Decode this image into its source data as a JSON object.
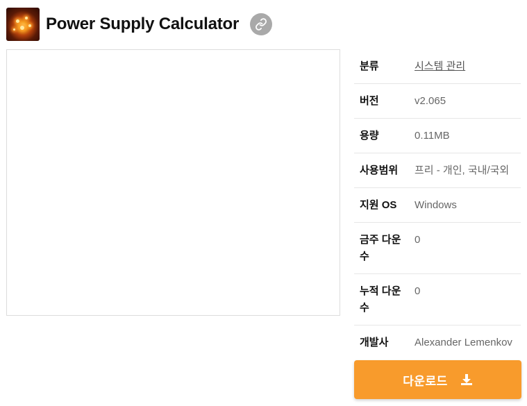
{
  "header": {
    "title": "Power Supply Calculator",
    "app_icon": "app-logo-icon",
    "link_icon": "link-icon"
  },
  "info": {
    "rows": [
      {
        "label": "분류",
        "value": "시스템 관리"
      },
      {
        "label": "버전",
        "value": "v2.065"
      },
      {
        "label": "용량",
        "value": "0.11MB"
      },
      {
        "label": "사용범위",
        "value": "프리 - 개인, 국내/국외"
      },
      {
        "label": "지원 OS",
        "value": "Windows"
      },
      {
        "label": "금주 다운수",
        "value": "0"
      },
      {
        "label": "누적 다운수",
        "value": "0"
      },
      {
        "label": "개발사",
        "value": "Alexander Lemenkov"
      }
    ]
  },
  "download": {
    "label": "다운로드",
    "icon": "download-icon"
  },
  "colors": {
    "accent": "#f89b2c",
    "link_button": "#a9a9a9",
    "label_text": "#111111",
    "value_text": "#666666",
    "divider": "#e6e6e6"
  }
}
